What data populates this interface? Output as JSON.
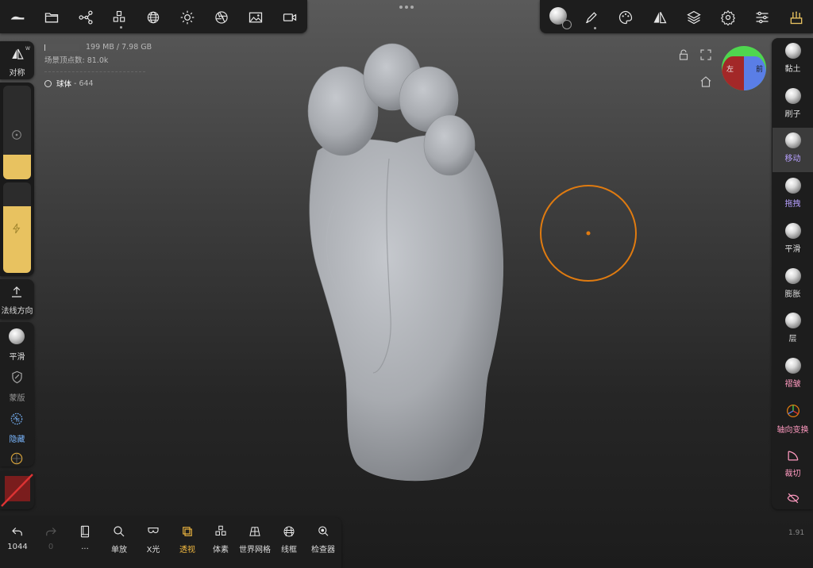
{
  "stats": {
    "memory": "199 MB / 7.98 GB",
    "memory_fraction": 0.025,
    "vertex_count": "场景顶点数: 81.0k",
    "object_name": "球体",
    "object_count": "- 644"
  },
  "left_panel": {
    "symmetry_label": "对称",
    "symmetry_badge": "W",
    "normal_dir_label": "法线方向",
    "smooth_label": "平滑",
    "mask_label": "蒙版",
    "hide_label": "隐藏",
    "radius_fraction": 0.26,
    "intensity_fraction": 0.74
  },
  "right_tools": [
    {
      "label": "黏土",
      "color": "#dddddd"
    },
    {
      "label": "刷子",
      "color": "#dddddd"
    },
    {
      "label": "移动",
      "color": "#b7a0ff",
      "active": true
    },
    {
      "label": "拖拽",
      "color": "#b7a0ff"
    },
    {
      "label": "平滑",
      "color": "#dddddd"
    },
    {
      "label": "膨胀",
      "color": "#dddddd"
    },
    {
      "label": "层",
      "color": "#dddddd"
    },
    {
      "label": "褶皱",
      "color": "#ff9ac0"
    },
    {
      "label": "轴向变换",
      "color": "#ff9ac0"
    },
    {
      "label": "裁切",
      "color": "#ff9ac0"
    }
  ],
  "bottom_toolbar": {
    "undo_count": "1044",
    "redo_count": "0",
    "more_label": "...",
    "items": [
      "单放",
      "X光",
      "透视",
      "体素",
      "世界网格",
      "线框",
      "检查器"
    ],
    "active_item": "透视"
  },
  "gizmo": {
    "left_label": "左",
    "front_label": "前"
  },
  "fps": "1.91",
  "colors": {
    "accent": "#e8c260",
    "brush_ring": "#e07b10",
    "active_text": "#f0b840",
    "purple": "#b7a0ff",
    "pink": "#ff9ac0",
    "gizmo_red": "#a32828",
    "gizmo_blue": "#5a7ee6",
    "gizmo_green": "#4fd64f"
  },
  "icons": {
    "top_left": [
      "nomad-logo-icon",
      "folder-icon",
      "share-graph-icon",
      "cubes-icon",
      "sphere-grid-icon",
      "sun-icon",
      "aperture-icon",
      "image-icon",
      "video-camera-icon"
    ],
    "top_right": [
      "material-sphere-icon",
      "pen-icon",
      "palette-icon",
      "symmetry-icon",
      "layers-icon",
      "gear-icon",
      "sliders-icon",
      "tools-icon"
    ]
  }
}
